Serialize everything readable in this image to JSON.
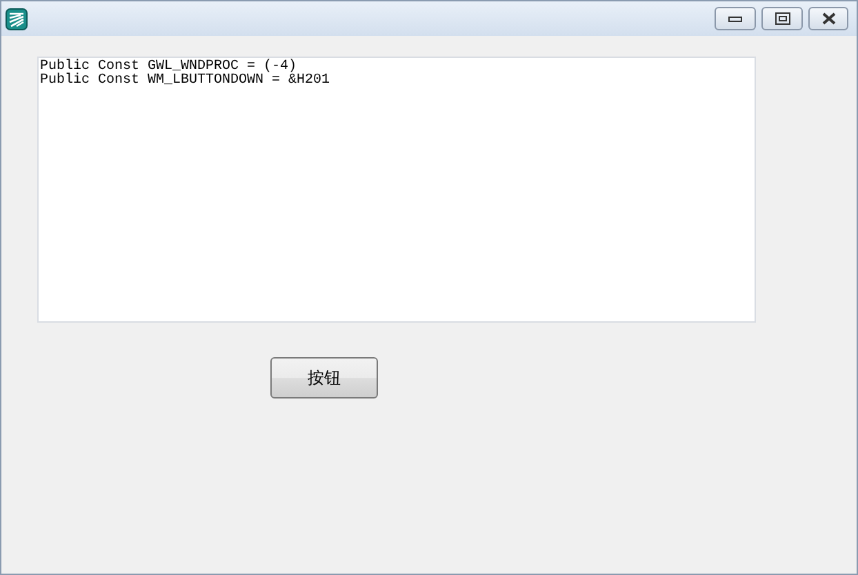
{
  "code_box": {
    "lines": [
      "Public Const GWL_WNDPROC = (-4)",
      "Public Const WM_LBUTTONDOWN = &H201"
    ]
  },
  "button": {
    "label": "按钮"
  }
}
